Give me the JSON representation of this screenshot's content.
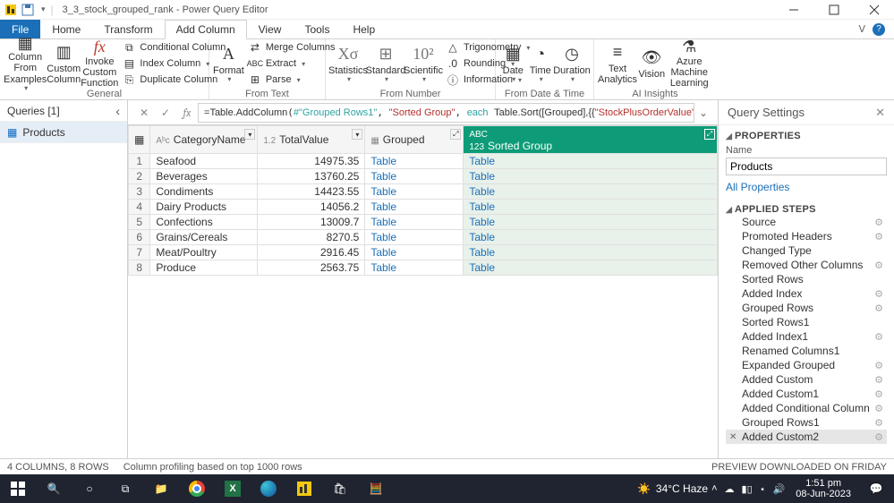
{
  "titlebar": {
    "title": "3_3_stock_grouped_rank - Power Query Editor"
  },
  "menu": {
    "file": "File",
    "home": "Home",
    "transform": "Transform",
    "add_column": "Add Column",
    "view": "View",
    "tools": "Tools",
    "help": "Help"
  },
  "ribbon": {
    "general": {
      "label": "General",
      "col_from_examples": "Column From Examples",
      "custom_column": "Custom Column",
      "invoke": "Invoke Custom Function"
    },
    "col_opts": {
      "conditional": "Conditional Column",
      "index": "Index Column",
      "duplicate": "Duplicate Column"
    },
    "from_text": {
      "label": "From Text",
      "format": "Format",
      "merge": "Merge Columns",
      "extract": "Extract",
      "parse": "Parse"
    },
    "from_number": {
      "label": "From Number",
      "statistics": "Statistics",
      "standard": "Standard",
      "scientific": "Scientific",
      "trig": "Trigonometry",
      "rounding": "Rounding",
      "information": "Information"
    },
    "from_dt": {
      "label": "From Date & Time",
      "date": "Date",
      "time": "Time",
      "duration": "Duration"
    },
    "ai": {
      "label": "AI Insights",
      "text": "Text Analytics",
      "vision": "Vision",
      "azure": "Azure Machine Learning"
    }
  },
  "queries": {
    "header": "Queries [1]",
    "items": [
      "Products"
    ]
  },
  "formula": {
    "prefix": "= ",
    "fn": "Table.AddColumn",
    "arg1": "#\"Grouped Rows1\"",
    "arg2": "\"Sorted Group\"",
    "kw_each": "each",
    "fn2": "Table.Sort",
    "rest": "([Grouped],{{",
    "arg3": "\"StockPlusOrderValue\"",
    "tail": ","
  },
  "grid": {
    "columns": [
      "CategoryName",
      "TotalValue",
      "Grouped",
      "Sorted Group"
    ],
    "rows": [
      {
        "n": 1,
        "c": "Seafood",
        "v": "14975.35",
        "g": "Table",
        "s": "Table"
      },
      {
        "n": 2,
        "c": "Beverages",
        "v": "13760.25",
        "g": "Table",
        "s": "Table"
      },
      {
        "n": 3,
        "c": "Condiments",
        "v": "14423.55",
        "g": "Table",
        "s": "Table"
      },
      {
        "n": 4,
        "c": "Dairy Products",
        "v": "14056.2",
        "g": "Table",
        "s": "Table"
      },
      {
        "n": 5,
        "c": "Confections",
        "v": "13009.7",
        "g": "Table",
        "s": "Table"
      },
      {
        "n": 6,
        "c": "Grains/Cereals",
        "v": "8270.5",
        "g": "Table",
        "s": "Table"
      },
      {
        "n": 7,
        "c": "Meat/Poultry",
        "v": "2916.45",
        "g": "Table",
        "s": "Table"
      },
      {
        "n": 8,
        "c": "Produce",
        "v": "2563.75",
        "g": "Table",
        "s": "Table"
      }
    ]
  },
  "settings": {
    "header": "Query Settings",
    "properties": "PROPERTIES",
    "name_label": "Name",
    "name_value": "Products",
    "all_props": "All Properties",
    "applied": "APPLIED STEPS",
    "steps": [
      {
        "label": "Source",
        "gear": true
      },
      {
        "label": "Promoted Headers",
        "gear": true
      },
      {
        "label": "Changed Type",
        "gear": false
      },
      {
        "label": "Removed Other Columns",
        "gear": true
      },
      {
        "label": "Sorted Rows",
        "gear": false
      },
      {
        "label": "Added Index",
        "gear": true
      },
      {
        "label": "Grouped Rows",
        "gear": true
      },
      {
        "label": "Sorted Rows1",
        "gear": false
      },
      {
        "label": "Added Index1",
        "gear": true
      },
      {
        "label": "Renamed Columns1",
        "gear": false
      },
      {
        "label": "Expanded Grouped",
        "gear": true
      },
      {
        "label": "Added Custom",
        "gear": true
      },
      {
        "label": "Added Custom1",
        "gear": true
      },
      {
        "label": "Added Conditional Column",
        "gear": true
      },
      {
        "label": "Grouped Rows1",
        "gear": true
      },
      {
        "label": "Added Custom2",
        "gear": true,
        "sel": true
      }
    ]
  },
  "status": {
    "left1": "4 COLUMNS, 8 ROWS",
    "left2": "Column profiling based on top 1000 rows",
    "right": "PREVIEW DOWNLOADED ON FRIDAY"
  },
  "taskbar": {
    "weather": "34°C  Haze",
    "time": "1:51 pm",
    "date": "08-Jun-2023"
  }
}
